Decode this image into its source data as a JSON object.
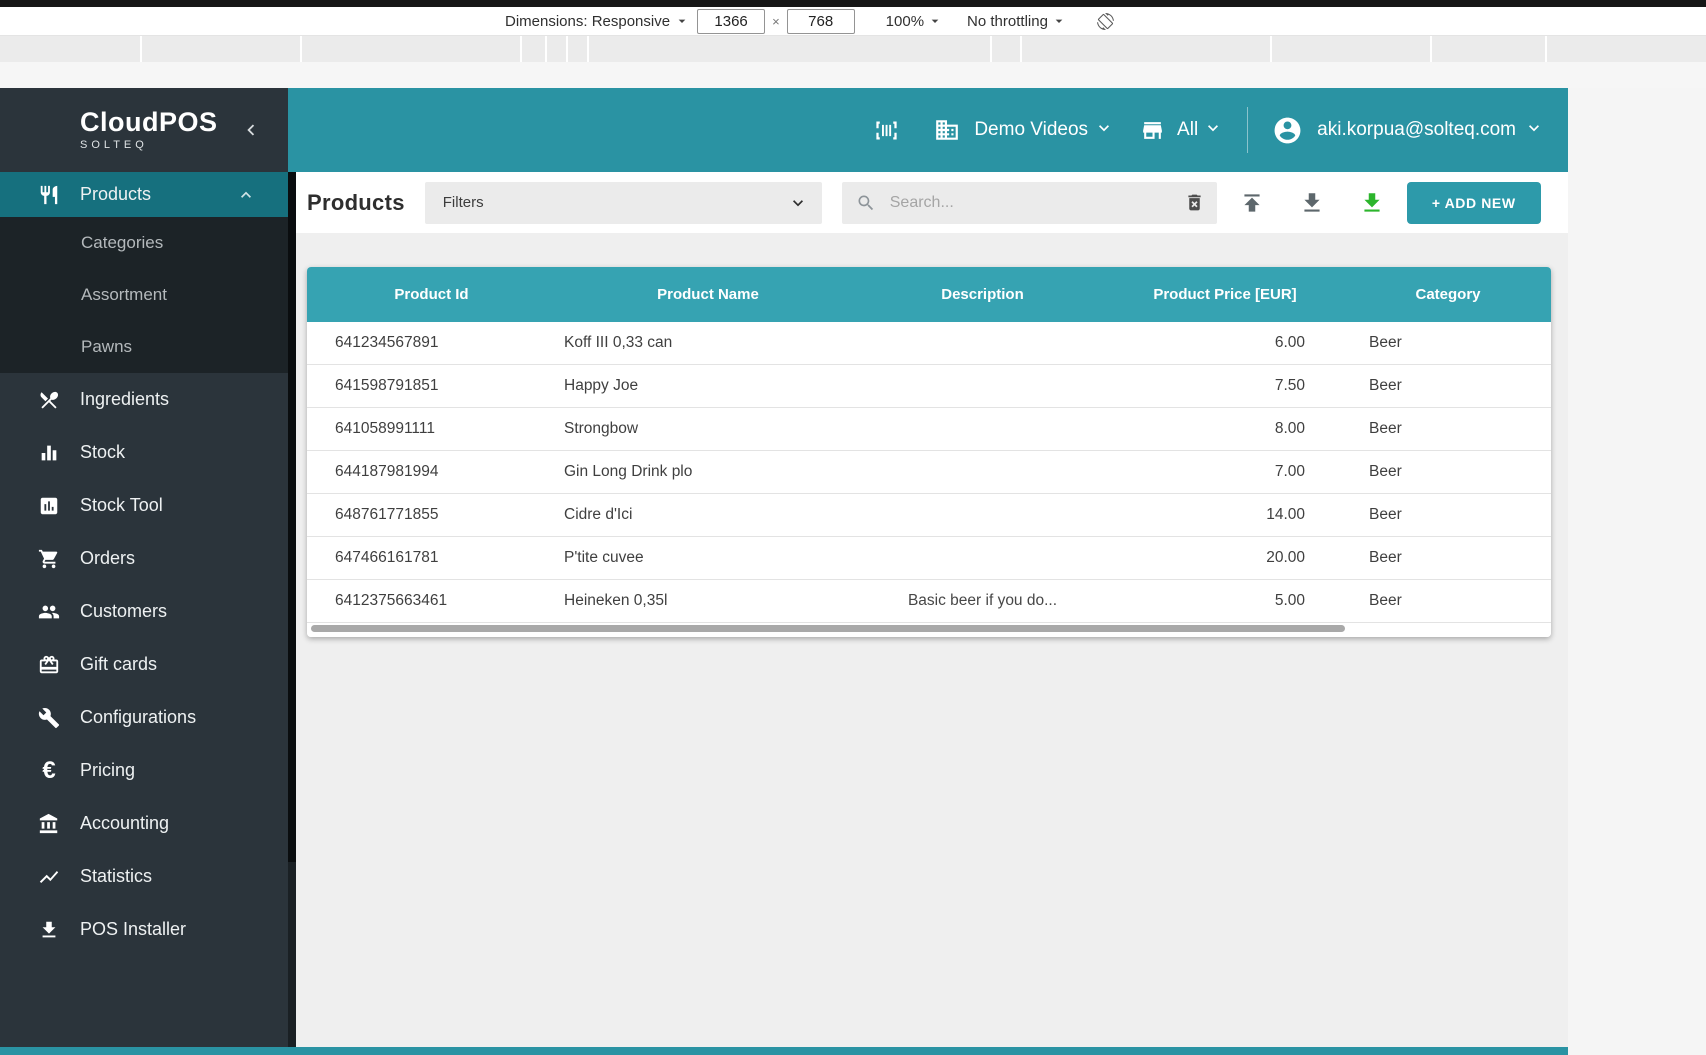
{
  "devtools": {
    "dimensions_label": "Dimensions: Responsive",
    "width_value": "1366",
    "separator": "×",
    "height_value": "768",
    "zoom_value": "100%",
    "throttling_value": "No throttling"
  },
  "app": {
    "logo": {
      "title": "CloudPOS",
      "subtitle": "SOLTEQ"
    },
    "header": {
      "company_selector": "Demo Videos",
      "store_selector": "All",
      "user_email": "aki.korpua@solteq.com"
    },
    "sidebar": {
      "active_item": "Products",
      "items": [
        {
          "label": "Products",
          "icon": "restaurant-icon"
        },
        {
          "label": "Ingredients",
          "icon": "restaurant-menu-icon"
        },
        {
          "label": "Stock",
          "icon": "bar-chart-icon"
        },
        {
          "label": "Stock Tool",
          "icon": "assessment-icon"
        },
        {
          "label": "Orders",
          "icon": "shopping-cart-icon"
        },
        {
          "label": "Customers",
          "icon": "people-icon"
        },
        {
          "label": "Gift cards",
          "icon": "gift-card-icon"
        },
        {
          "label": "Configurations",
          "icon": "wrench-icon"
        },
        {
          "label": "Pricing",
          "icon": "euro-icon"
        },
        {
          "label": "Accounting",
          "icon": "bank-icon"
        },
        {
          "label": "Statistics",
          "icon": "trend-line-icon"
        },
        {
          "label": "POS Installer",
          "icon": "download-icon"
        }
      ],
      "products_submenu": [
        {
          "label": "Categories"
        },
        {
          "label": "Assortment"
        },
        {
          "label": "Pawns"
        }
      ]
    },
    "toolbar": {
      "page_title": "Products",
      "filters_label": "Filters",
      "search_placeholder": "Search...",
      "add_new_label": "+ ADD NEW",
      "action_icons": [
        "upload-icon",
        "download-icon",
        "download-green-icon"
      ]
    },
    "table": {
      "columns": [
        "Product Id",
        "Product Name",
        "Description",
        "Product Price [EUR]",
        "Category"
      ],
      "rows": [
        {
          "id": "641234567891",
          "name": "Koff III 0,33 can",
          "description": "",
          "price": "6.00",
          "category": "Beer"
        },
        {
          "id": "641598791851",
          "name": "Happy Joe",
          "description": "",
          "price": "7.50",
          "category": "Beer"
        },
        {
          "id": "641058991111",
          "name": "Strongbow",
          "description": "",
          "price": "8.00",
          "category": "Beer"
        },
        {
          "id": "644187981994",
          "name": "Gin Long Drink plo",
          "description": "",
          "price": "7.00",
          "category": "Beer"
        },
        {
          "id": "648761771855",
          "name": "Cidre d'Ici",
          "description": "",
          "price": "14.00",
          "category": "Beer"
        },
        {
          "id": "647466161781",
          "name": "P'tite cuvee",
          "description": "",
          "price": "20.00",
          "category": "Beer"
        },
        {
          "id": "6412375663461",
          "name": "Heineken 0,35l",
          "description": "Basic beer if you do...",
          "price": "5.00",
          "category": "Beer"
        }
      ]
    },
    "colors": {
      "accent_teal": "#2a93a3",
      "table_header_teal": "#36a3b2",
      "add_button_teal": "#2d9aaa",
      "sidebar_dark": "#2b343b",
      "submenu_dark": "#1c2327",
      "active_item_teal": "#16707e",
      "download_green": "#2cb52c",
      "content_gray": "#efefef"
    }
  }
}
